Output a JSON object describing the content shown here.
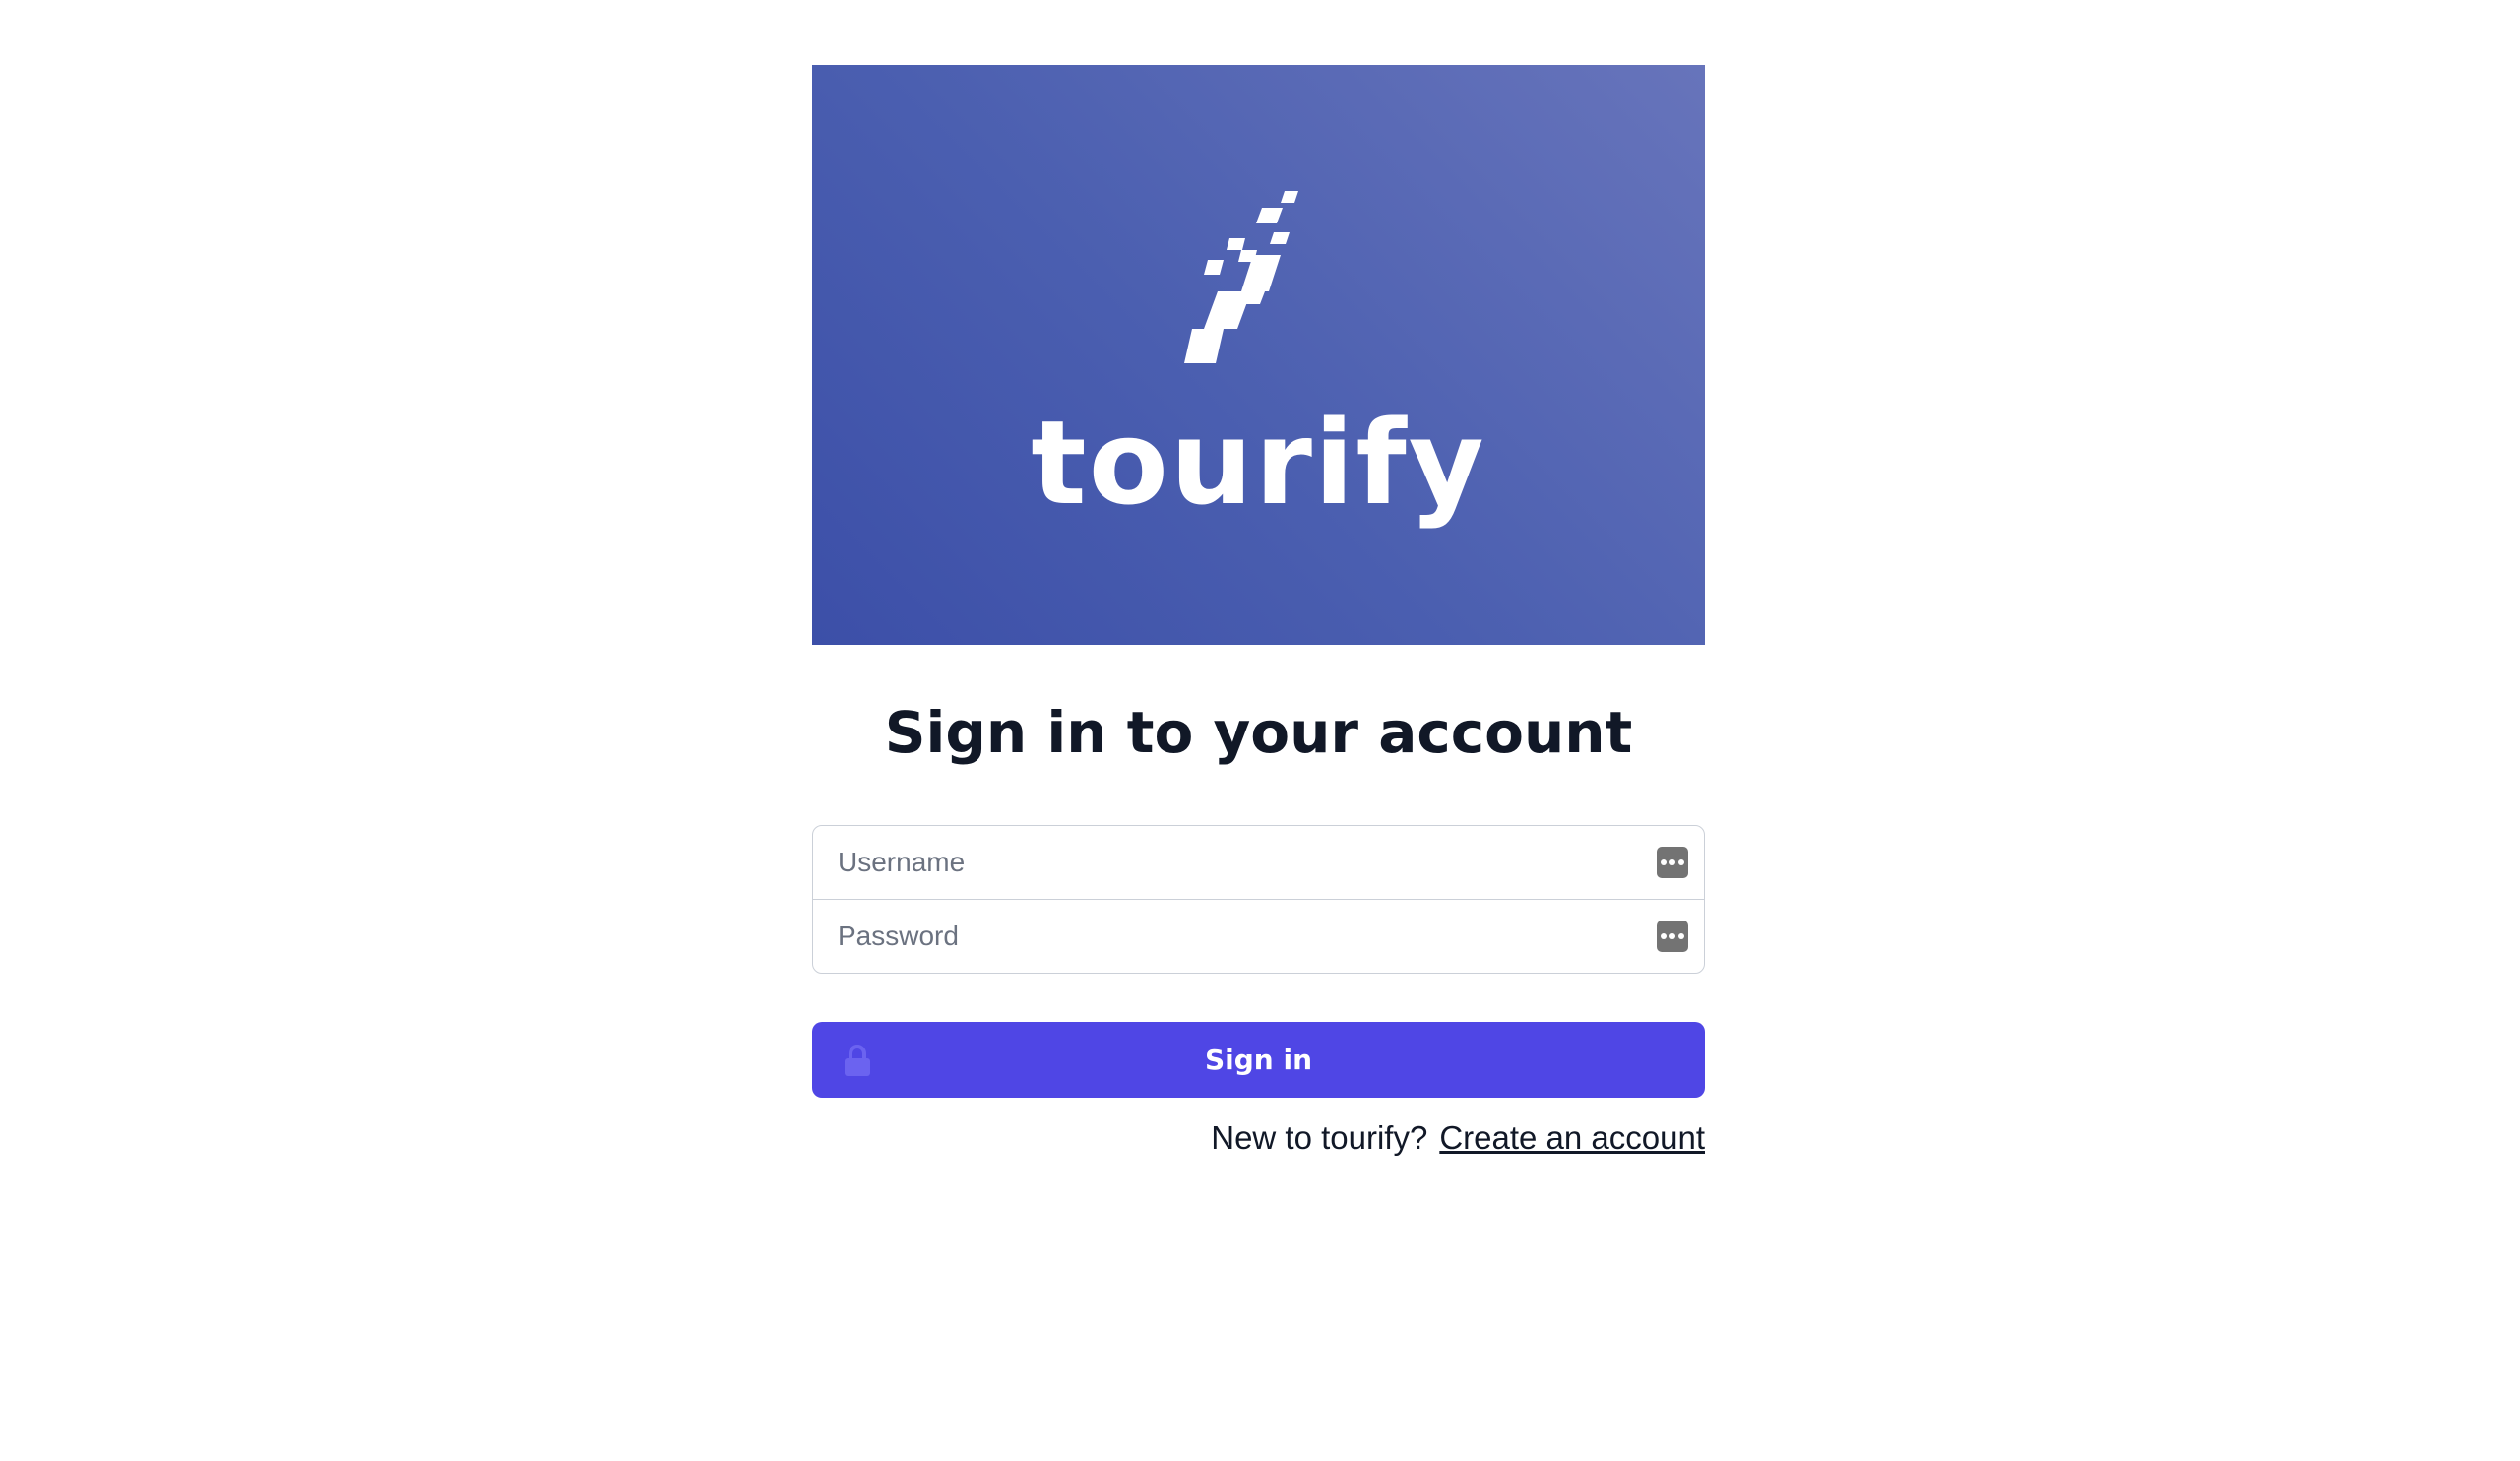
{
  "brand": {
    "name": "tourify",
    "logo_icon": "checkered-flag-icon",
    "hero_gradient": [
      "#3c4fa8",
      "#6774bb"
    ]
  },
  "heading": "Sign in to your account",
  "form": {
    "username_placeholder": "Username",
    "username_value": "",
    "password_placeholder": "Password",
    "password_value": "",
    "password_manager_icon": "password-manager-icon",
    "submit_label": "Sign in",
    "submit_icon": "lock-icon",
    "accent_color": "#4f46e5"
  },
  "footer": {
    "prompt": "New to tourify?",
    "link_label": "Create an account"
  }
}
